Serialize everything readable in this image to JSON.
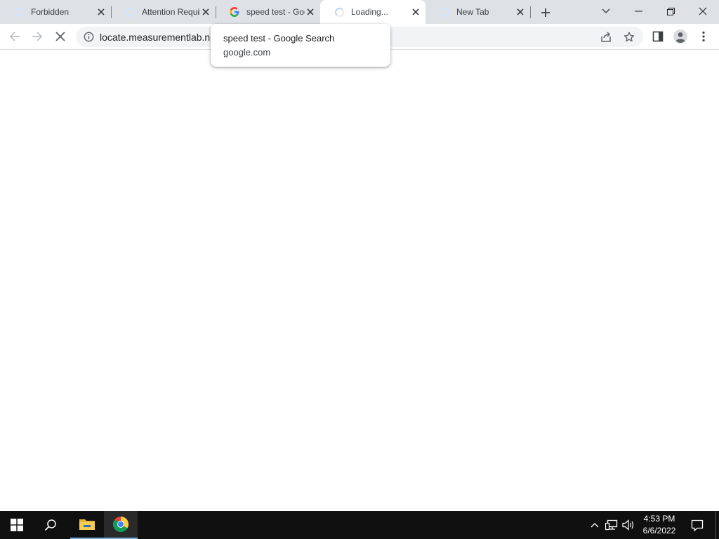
{
  "tabs": [
    {
      "title": "Forbidden",
      "icon": "loading-spinner"
    },
    {
      "title": "Attention Required",
      "icon": "loading-spinner"
    },
    {
      "title": "speed test - Google Search",
      "icon": "google-g"
    },
    {
      "title": "Loading...",
      "icon": "loading-spinner",
      "active": true
    },
    {
      "title": "New Tab",
      "icon": "loading-spinner"
    }
  ],
  "hovercard": {
    "title": "speed test - Google Search",
    "domain": "google.com"
  },
  "omnibox": {
    "url": "locate.measurementlab.net"
  },
  "taskbar": {
    "time": "4:53 PM",
    "date": "6/6/2022"
  },
  "colors": {
    "tabstrip_bg": "#dee1e6",
    "taskbar_bg": "#101010",
    "accent": "#1a73e8"
  }
}
